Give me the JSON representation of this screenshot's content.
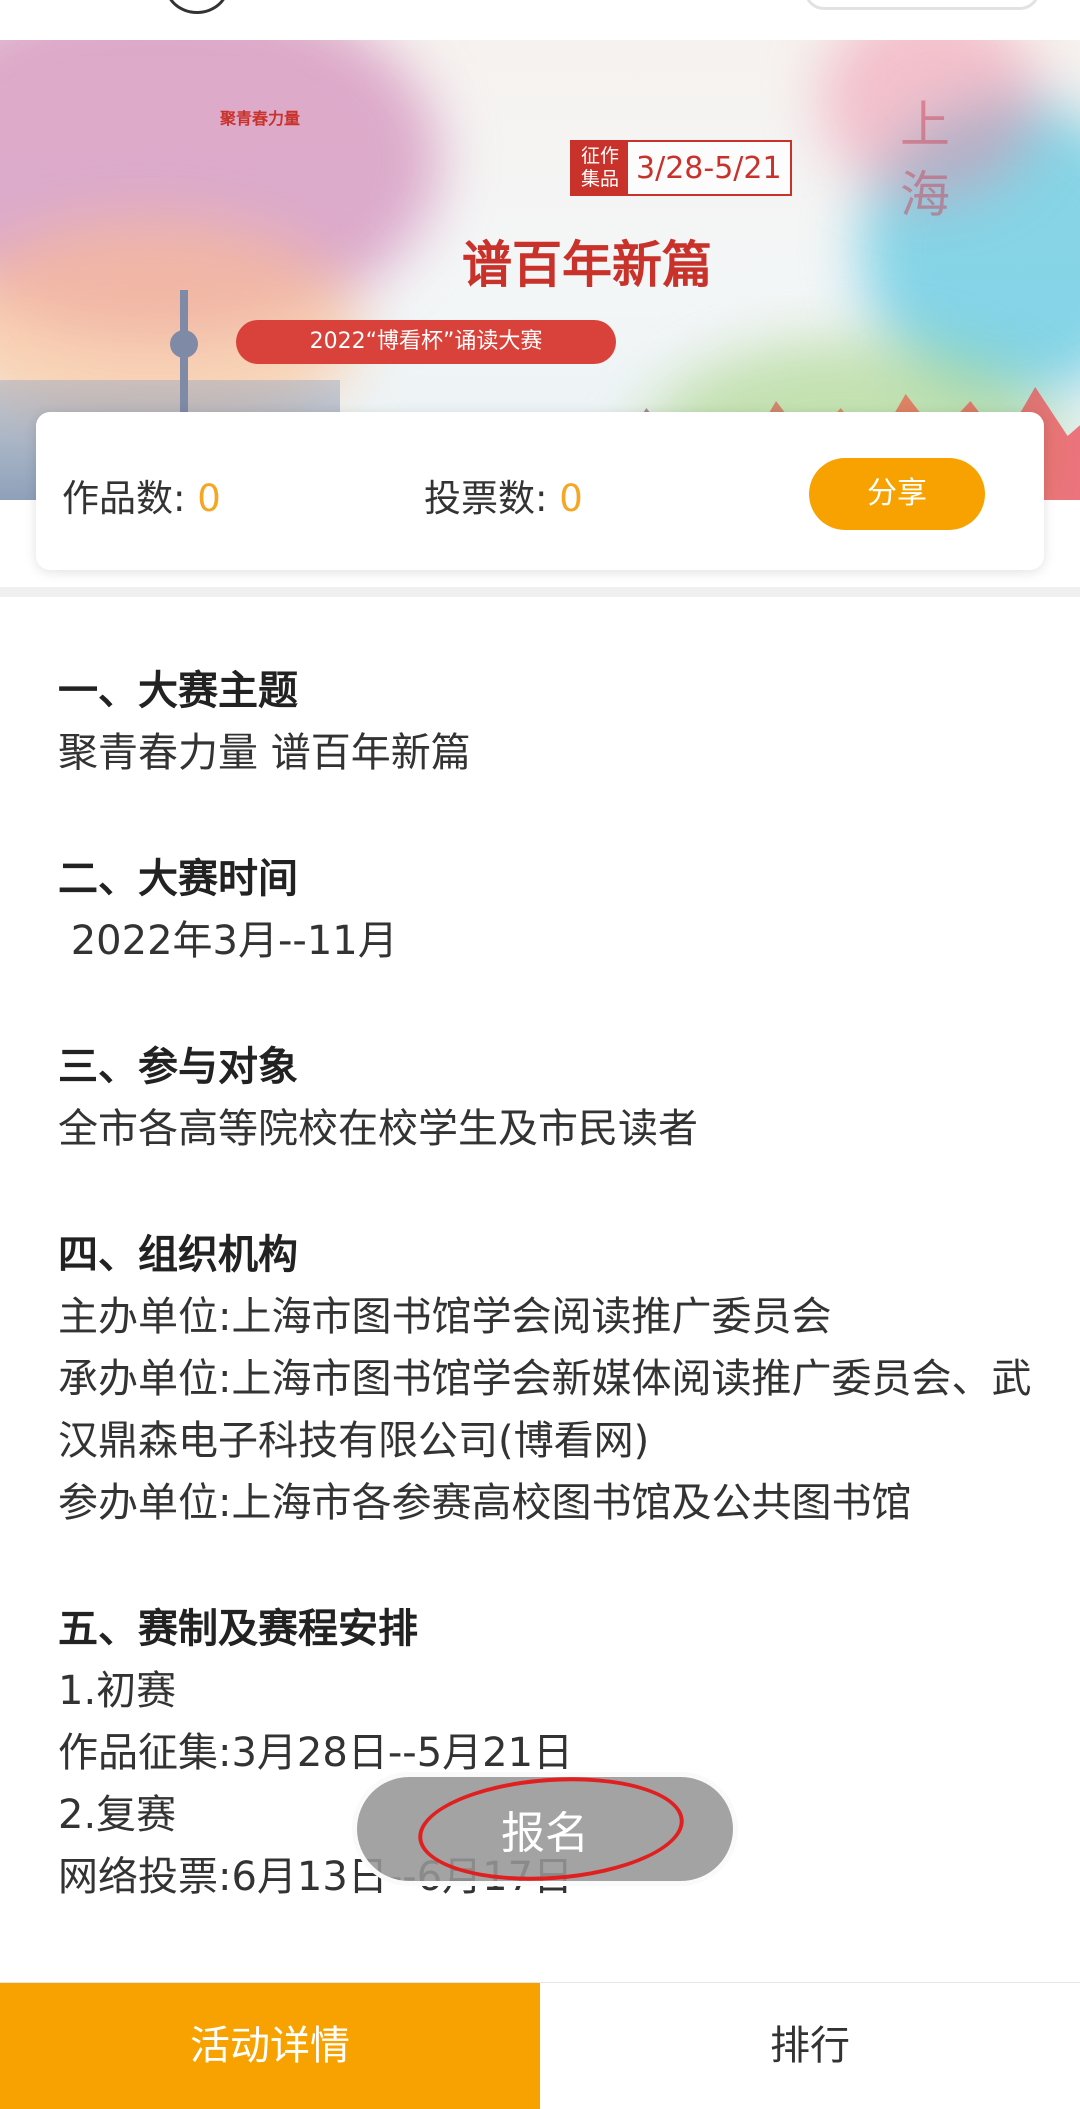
{
  "banner": {
    "title_line1": "聚青春力量",
    "stamp_tag": "征作集品",
    "stamp_dates": "3/28-5/21",
    "title_line2": "谱百年新篇",
    "ribbon": "2022“博看杯”诵读大赛",
    "deco_text": "上海"
  },
  "stats": {
    "works_label": "作品数:",
    "works_value": "0",
    "votes_label": "投票数:",
    "votes_value": "0",
    "share_label": "分享"
  },
  "sections": [
    {
      "heading": "一、大赛主题",
      "lines": [
        "聚青春力量 谱百年新篇"
      ]
    },
    {
      "heading": "二、大赛时间",
      "lines": [
        " 2022年3月--11月"
      ]
    },
    {
      "heading": "三、参与对象",
      "lines": [
        "全市各高等院校在校学生及市民读者"
      ]
    },
    {
      "heading": "四、组织机构",
      "lines": [
        "主办单位:上海市图书馆学会阅读推广委员会",
        "承办单位:上海市图书馆学会新媒体阅读推广委员会、武汉鼎森电子科技有限公司(博看网)",
        "参办单位:上海市各参赛高校图书馆及公共图书馆"
      ]
    },
    {
      "heading": "五、赛制及赛程安排",
      "lines": [
        "1.初赛",
        "作品征集:3月28日--5月21日",
        "2.复赛",
        "网络投票:6月13日--6月17日"
      ]
    }
  ],
  "signup_label": "报名",
  "bottom_nav": {
    "details_label": "活动详情",
    "ranking_label": "排行"
  },
  "colors": {
    "accent": "#f7a200",
    "title_red": "#c8322a",
    "stat_value": "#f5a623"
  }
}
